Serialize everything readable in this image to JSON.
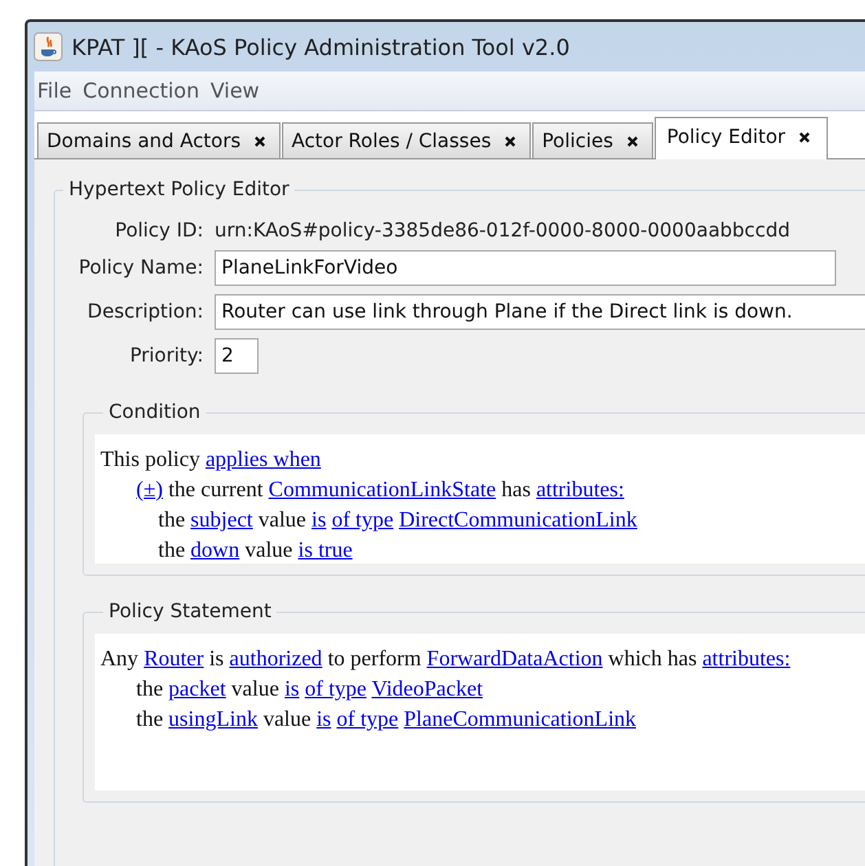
{
  "window": {
    "title": "KPAT ][ - KAoS Policy Administration Tool v2.0"
  },
  "menu": [
    "File",
    "Connection",
    "View"
  ],
  "tabs": [
    {
      "label": "Domains and Actors",
      "selected": false
    },
    {
      "label": "Actor Roles / Classes",
      "selected": false
    },
    {
      "label": "Policies",
      "selected": false
    },
    {
      "label": "Policy Editor",
      "selected": true
    }
  ],
  "editor": {
    "title": "Hypertext Policy Editor",
    "policy_id": {
      "label": "Policy ID:",
      "value": "urn:KAoS#policy-3385de86-012f-0000-8000-0000aabbccdd"
    },
    "fields": [
      {
        "label": "Policy Name:",
        "value": "PlaneLinkForVideo",
        "kind": "name"
      },
      {
        "label": "Description:",
        "value": "Router can use link through Plane if the Direct link is down.",
        "kind": "description"
      },
      {
        "label": "Priority:",
        "value": "2",
        "kind": "priority"
      }
    ],
    "sections": [
      {
        "title": "Condition",
        "kind": "condition",
        "lines": [
          {
            "segments": [
              {
                "kind": "text",
                "text": "This policy"
              },
              {
                "kind": "link",
                "text": "applies when"
              }
            ],
            "children": [
              {
                "segments": [
                  {
                    "kind": "link",
                    "text": "(±)"
                  },
                  {
                    "kind": "text",
                    "text": "the current"
                  },
                  {
                    "kind": "link",
                    "text": "CommunicationLinkState"
                  },
                  {
                    "kind": "text",
                    "text": "has"
                  },
                  {
                    "kind": "link",
                    "text": "attributes:"
                  }
                ],
                "children": [
                  {
                    "segments": [
                      {
                        "kind": "text",
                        "text": "the"
                      },
                      {
                        "kind": "link",
                        "text": "subject"
                      },
                      {
                        "kind": "text",
                        "text": "value"
                      },
                      {
                        "kind": "link",
                        "text": "is"
                      },
                      {
                        "kind": "link",
                        "text": "of type"
                      },
                      {
                        "kind": "link",
                        "text": "DirectCommunicationLink"
                      }
                    ]
                  },
                  {
                    "segments": [
                      {
                        "kind": "text",
                        "text": "the"
                      },
                      {
                        "kind": "link",
                        "text": "down"
                      },
                      {
                        "kind": "text",
                        "text": "value"
                      },
                      {
                        "kind": "link",
                        "text": "is true"
                      }
                    ]
                  }
                ]
              }
            ]
          }
        ]
      },
      {
        "title": "Policy Statement",
        "kind": "statement",
        "lines": [
          {
            "segments": [
              {
                "kind": "text",
                "text": "Any"
              },
              {
                "kind": "link",
                "text": "Router"
              },
              {
                "kind": "text",
                "text": "is"
              },
              {
                "kind": "link",
                "text": "authorized"
              },
              {
                "kind": "text",
                "text": "to perform"
              },
              {
                "kind": "link",
                "text": "ForwardDataAction"
              },
              {
                "kind": "text",
                "text": "which has"
              },
              {
                "kind": "link",
                "text": "attributes:"
              }
            ],
            "children": [
              {
                "segments": [
                  {
                    "kind": "text",
                    "text": "the"
                  },
                  {
                    "kind": "link",
                    "text": "packet"
                  },
                  {
                    "kind": "text",
                    "text": "value"
                  },
                  {
                    "kind": "link",
                    "text": "is"
                  },
                  {
                    "kind": "link",
                    "text": "of type"
                  },
                  {
                    "kind": "link",
                    "text": "VideoPacket"
                  }
                ]
              },
              {
                "segments": [
                  {
                    "kind": "text",
                    "text": "the"
                  },
                  {
                    "kind": "link",
                    "text": "usingLink"
                  },
                  {
                    "kind": "text",
                    "text": "value"
                  },
                  {
                    "kind": "link",
                    "text": "is"
                  },
                  {
                    "kind": "link",
                    "text": "of type"
                  },
                  {
                    "kind": "link",
                    "text": "PlaneCommunicationLink"
                  }
                ]
              }
            ]
          }
        ]
      }
    ]
  }
}
